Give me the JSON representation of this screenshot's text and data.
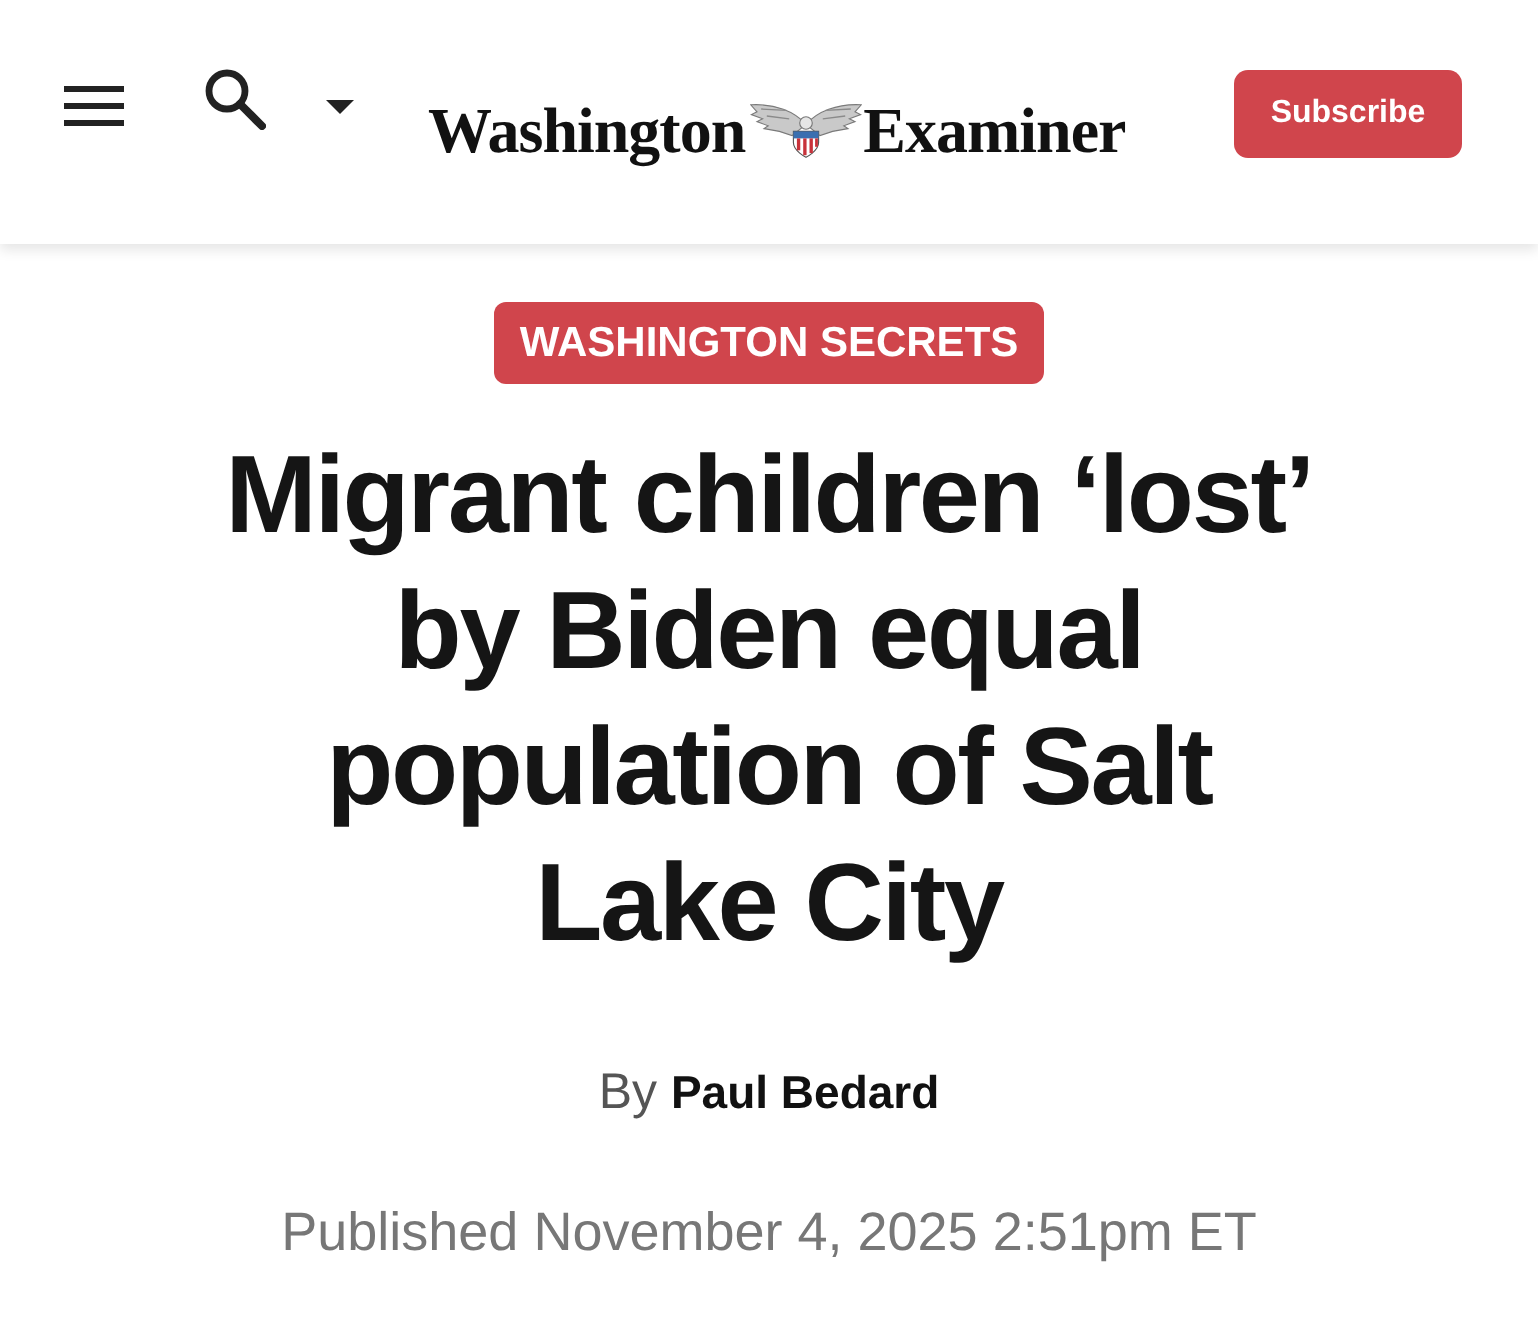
{
  "header": {
    "logo": {
      "left": "Washington",
      "right": "Examiner"
    },
    "subscribe_button": "Subscribe"
  },
  "article": {
    "category": "WASHINGTON SECRETS",
    "headline": "Migrant children ‘lost’ by Biden equal population of Salt Lake City",
    "byline": "By **Paul Bedard**",
    "published": "Published November 4, 2025 2:51pm ET"
  }
}
